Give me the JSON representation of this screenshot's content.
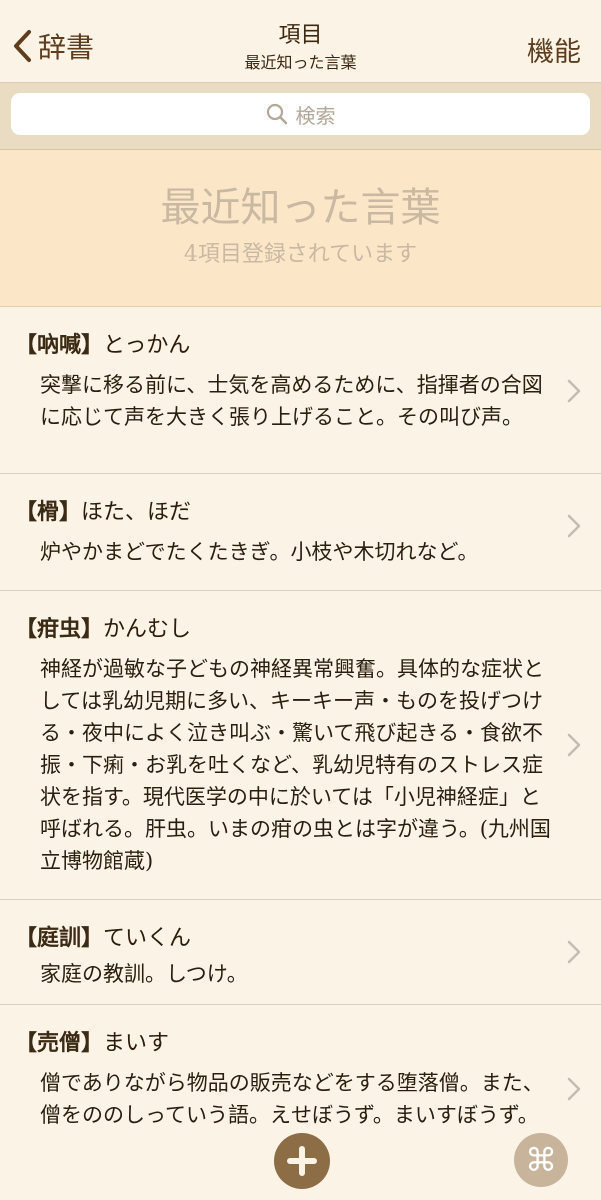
{
  "nav": {
    "back_label": "辞書",
    "title": "項目",
    "subtitle": "最近知った言葉",
    "menu_label": "機能"
  },
  "search": {
    "placeholder": "検索"
  },
  "header": {
    "title": "最近知った言葉",
    "subtitle": "4項目登録されています"
  },
  "entries": [
    {
      "word": "【吶喊】",
      "reading": "とっかん",
      "definition": "突撃に移る前に、士気を高めるために、指揮者の合図に応じて声を大きく張り上げること。その叫び声。"
    },
    {
      "word": "【榾】",
      "reading": "ほた、ほだ",
      "definition": "炉やかまどでたくたきぎ。小枝や木切れなど。"
    },
    {
      "word": "【疳虫】",
      "reading": "かんむし",
      "definition": "神経が過敏な子どもの神経異常興奮。具体的な症状としては乳幼児期に多い、キーキー声・ものを投げつける・夜中によく泣き叫ぶ・驚いて飛び起きる・食欲不振・下痢・お乳を吐くなど、乳幼児特有のストレス症状を指す。現代医学の中に於いては「小児神経症」と呼ばれる。肝虫。いまの疳の虫とは字が違う。(九州国立博物館蔵)"
    },
    {
      "word": "【庭訓】",
      "reading": "ていくん",
      "definition": "家庭の教訓。しつけ。"
    },
    {
      "word": "【売僧】",
      "reading": "まいす",
      "definition": "僧でありながら物品の販売などをする堕落僧。また、僧をののしっていう語。えせぼうず。まいすぼうず。"
    }
  ],
  "toolbar": {
    "command_glyph": "⌘"
  },
  "icons": {
    "back": "chevron-left-icon",
    "search": "search-icon",
    "chevron": "chevron-right-icon",
    "add": "plus-icon",
    "command": "command-icon"
  },
  "colors": {
    "background": "#fbf3e5",
    "header_bg": "#fbe6c7",
    "accent_brown": "#5e3d1e",
    "add_button": "#8c6d45",
    "command_button": "#c7b49b"
  }
}
